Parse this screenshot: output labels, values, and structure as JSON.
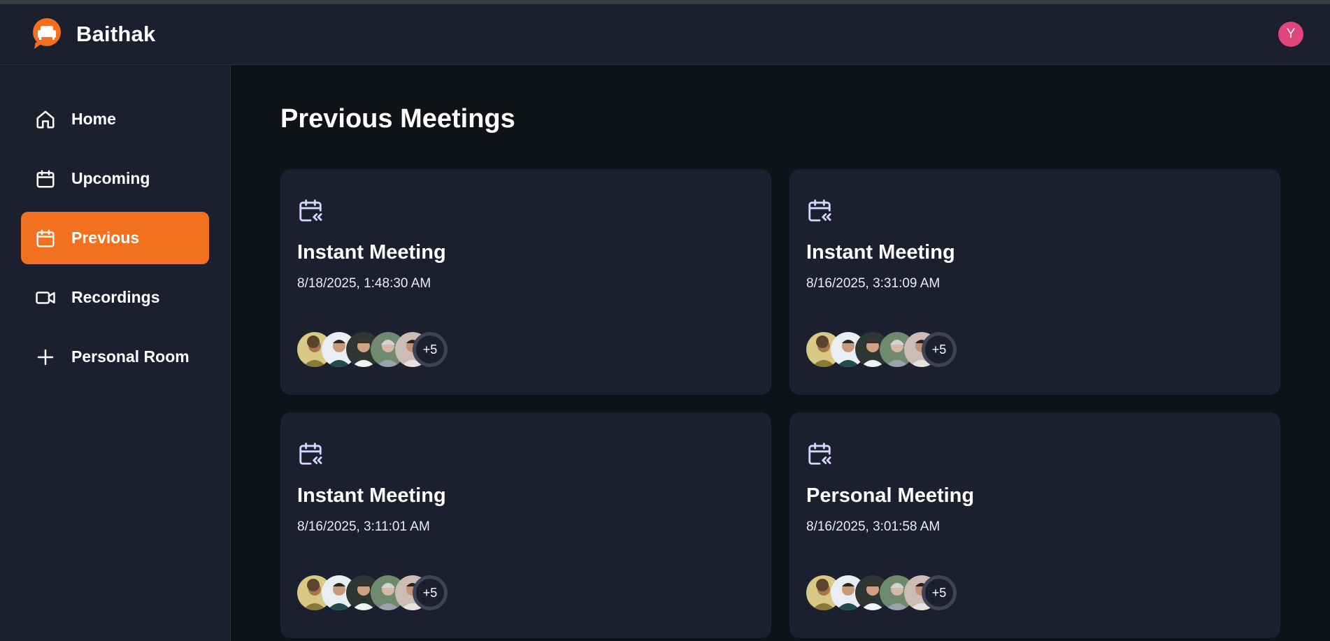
{
  "app": {
    "name": "Baithak",
    "user_initial": "Y",
    "accent_color": "#f37021",
    "user_avatar_color": "#e0457b"
  },
  "sidebar": {
    "items": [
      {
        "label": "Home",
        "icon": "home-icon",
        "active": false
      },
      {
        "label": "Upcoming",
        "icon": "calendar-icon",
        "active": false
      },
      {
        "label": "Previous",
        "icon": "calendar-icon",
        "active": true
      },
      {
        "label": "Recordings",
        "icon": "video-icon",
        "active": false
      },
      {
        "label": "Personal Room",
        "icon": "plus-icon",
        "active": false
      }
    ]
  },
  "main": {
    "title": "Previous Meetings",
    "meetings": [
      {
        "title": "Instant Meeting",
        "date": "8/18/2025, 1:48:30 AM",
        "more_count": "+5",
        "icon": "calendar-previous-icon"
      },
      {
        "title": "Instant Meeting",
        "date": "8/16/2025, 3:31:09 AM",
        "more_count": "+5",
        "icon": "calendar-previous-icon"
      },
      {
        "title": "Instant Meeting",
        "date": "8/16/2025, 3:11:01 AM",
        "more_count": "+5",
        "icon": "calendar-previous-icon"
      },
      {
        "title": "Personal Meeting",
        "date": "8/16/2025, 3:01:58 AM",
        "more_count": "+5",
        "icon": "calendar-previous-icon"
      }
    ]
  }
}
